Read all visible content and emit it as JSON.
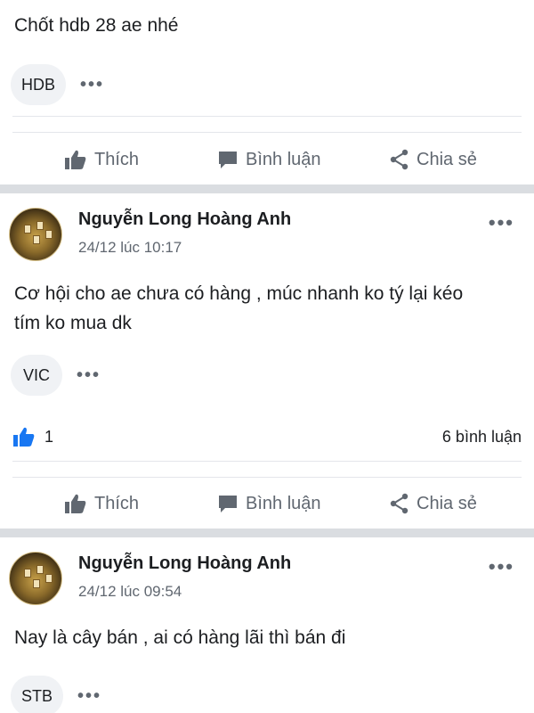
{
  "colors": {
    "accent": "#1877f2",
    "muted": "#606770",
    "separator": "#dadde1"
  },
  "post0": {
    "text": "Chốt hdb 28 ae nhé",
    "tag": "HDB",
    "more": "•••"
  },
  "actions": {
    "like": "Thích",
    "comment": "Bình luận",
    "share": "Chia sẻ"
  },
  "post1": {
    "author": "Nguyễn Long Hoàng Anh",
    "time": "24/12 lúc 10:17",
    "menu": "•••",
    "text_line1": "Cơ hội cho ae chưa có hàng , múc nhanh ko tý lại kéo",
    "text_line2": "tím ko mua dk",
    "tag": "VIC",
    "more": "•••",
    "likes": "1",
    "comments": "6 bình luận"
  },
  "post2": {
    "author": "Nguyễn Long Hoàng Anh",
    "time": "24/12 lúc 09:54",
    "menu": "•••",
    "text": "Nay là cây bán , ai có hàng lãi thì bán đi",
    "tag": "STB",
    "more": "•••"
  },
  "icons": {
    "like": "thumbs-up-icon",
    "comment": "comment-bubble-icon",
    "share": "share-icon",
    "reaction": "like-reaction-icon"
  }
}
